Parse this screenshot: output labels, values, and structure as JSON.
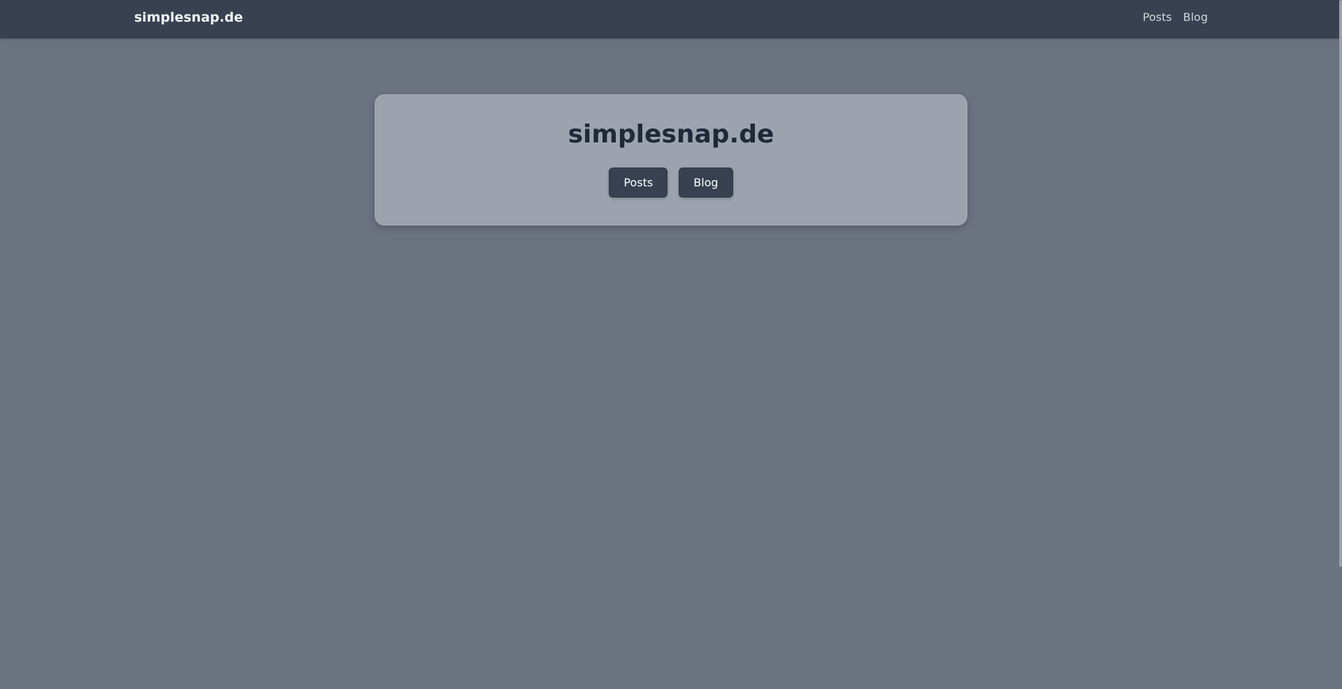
{
  "header": {
    "brand": "simplesnap.de",
    "nav": [
      {
        "label": "Posts"
      },
      {
        "label": "Blog"
      }
    ]
  },
  "hero": {
    "title": "simplesnap.de",
    "buttons": [
      {
        "label": "Posts"
      },
      {
        "label": "Blog"
      }
    ]
  },
  "colors": {
    "header_bg": "#374151",
    "page_bg": "#6b7280",
    "card_bg": "#9ca3af",
    "button_bg": "#374151"
  }
}
